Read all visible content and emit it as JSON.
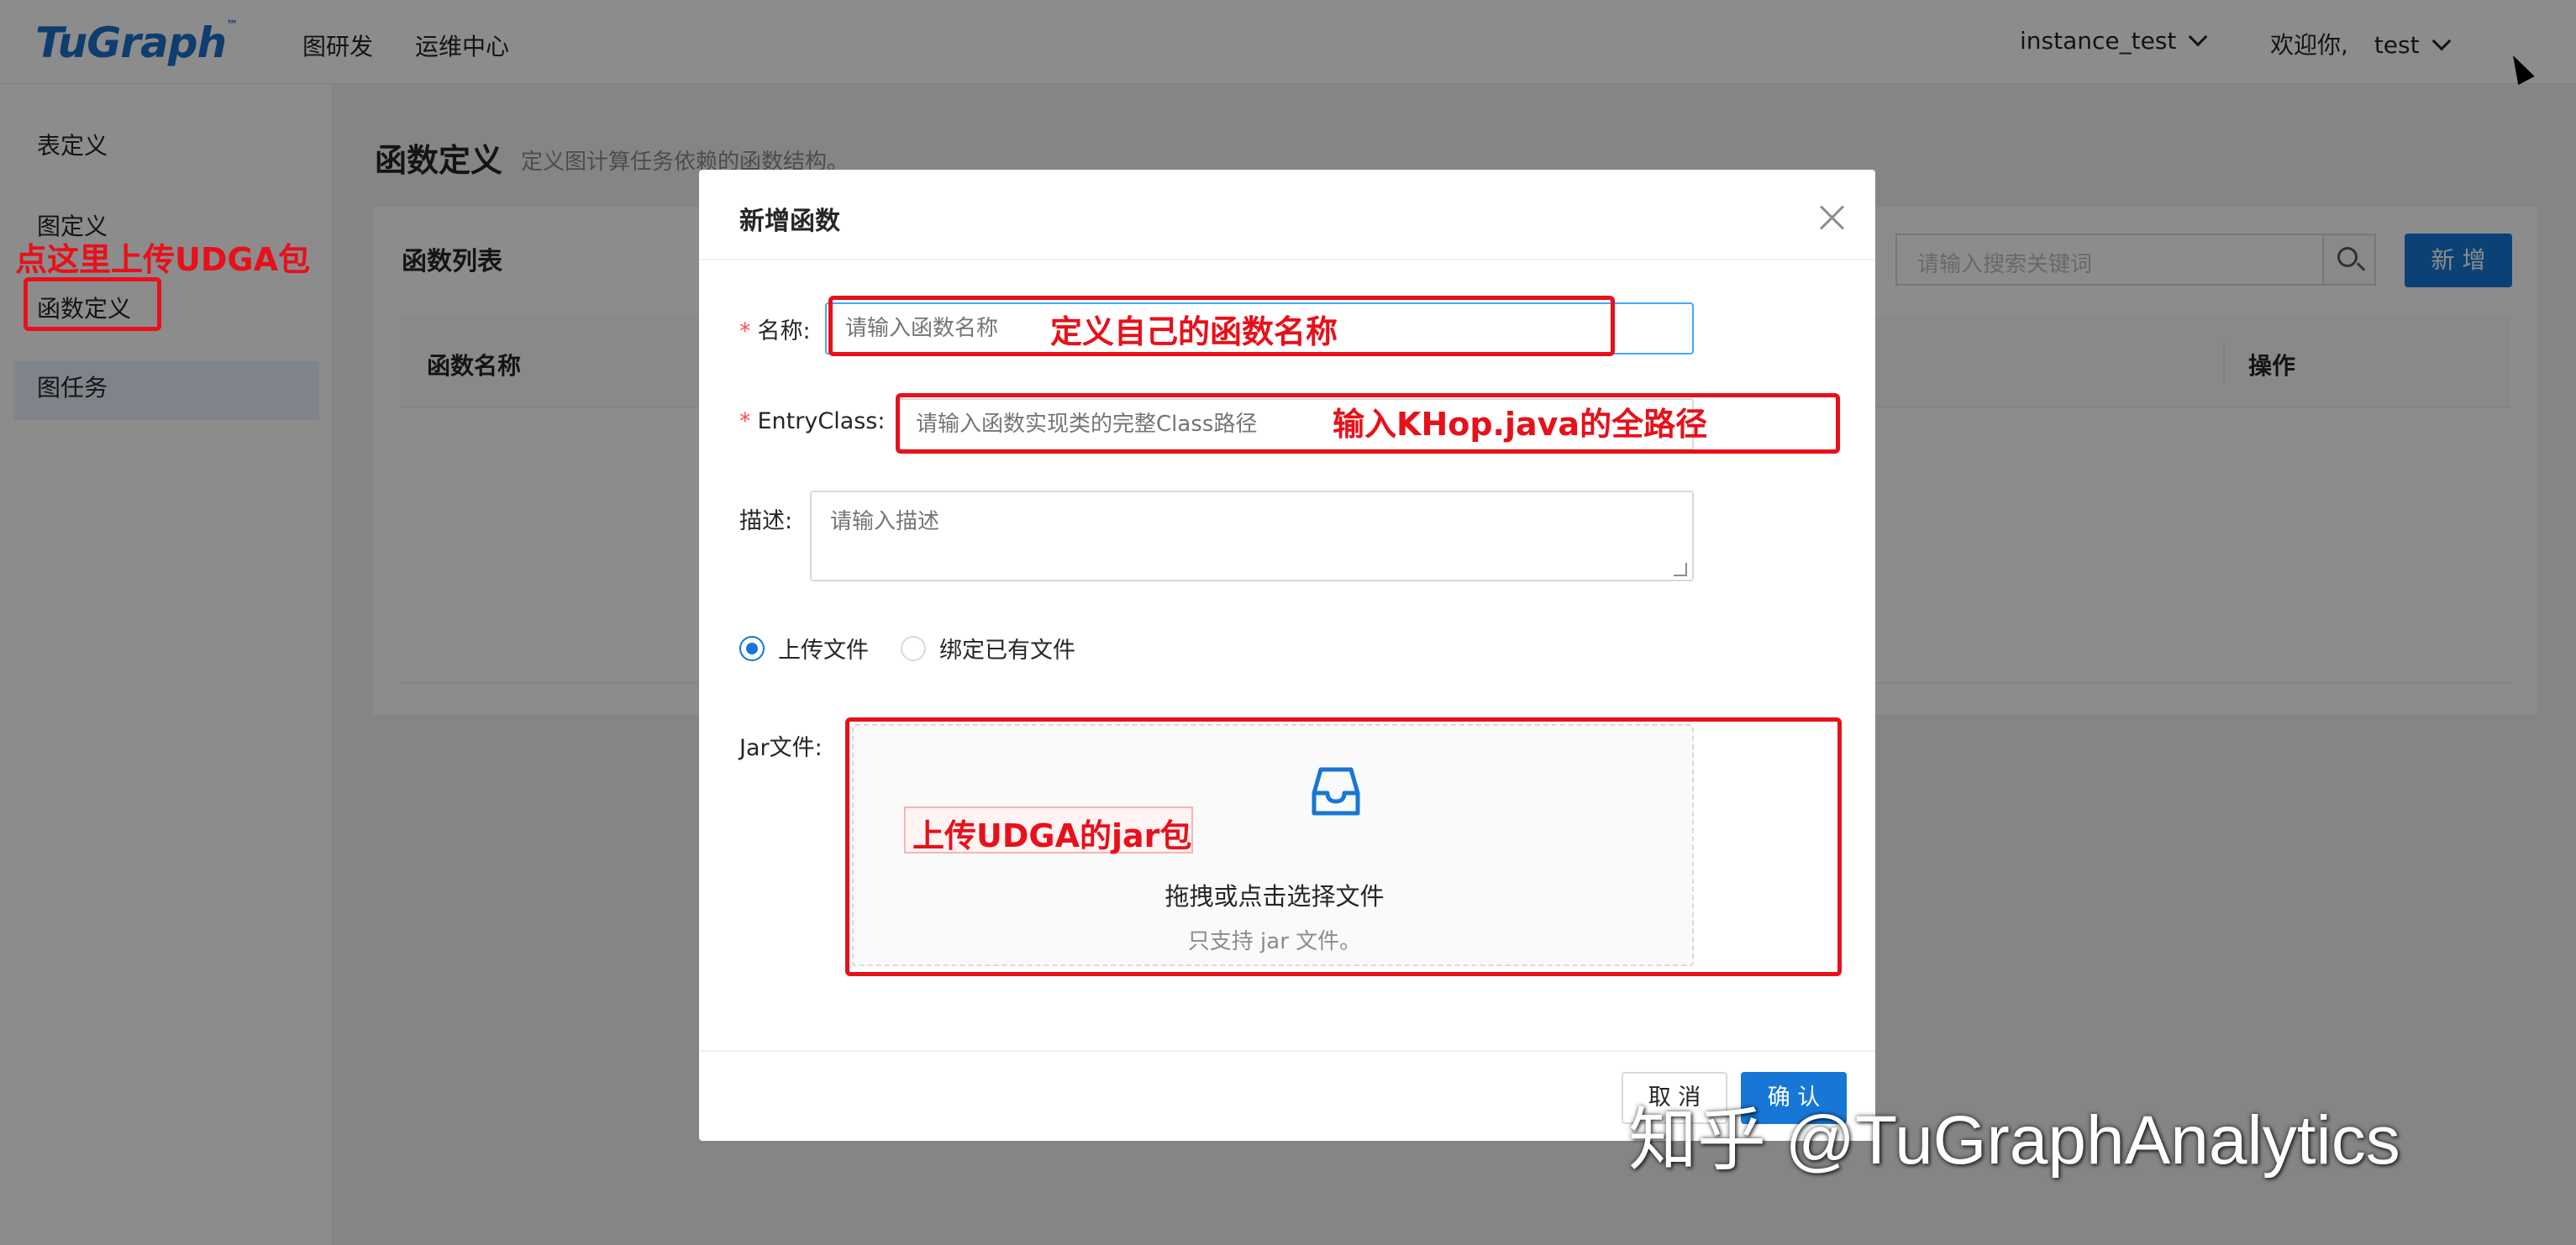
{
  "app": {
    "logo": "TuGraph",
    "logo_tm": "™",
    "nav": [
      "图研发",
      "运维中心"
    ],
    "instance": "instance_test",
    "greeting": "欢迎你,",
    "user": "test"
  },
  "sidebar": {
    "items": [
      {
        "label": "表定义"
      },
      {
        "label": "图定义"
      },
      {
        "label": "函数定义",
        "selected": true
      },
      {
        "label": "图任务"
      }
    ]
  },
  "page": {
    "title": "函数定义",
    "subtitle": "定义图计算任务依赖的函数结构。",
    "card_title": "函数列表",
    "search_placeholder": "请输入搜索关键词",
    "add_label": "新 增",
    "columns": [
      "函数名称",
      "操作"
    ]
  },
  "modal": {
    "title": "新增函数",
    "name_label": "名称:",
    "name_placeholder": "请输入函数名称",
    "entry_label": "EntryClass:",
    "entry_placeholder": "请输入函数实现类的完整Class路径",
    "desc_label": "描述:",
    "desc_placeholder": "请输入描述",
    "radio_upload": "上传文件",
    "radio_bind": "绑定已有文件",
    "radio_selected": "上传文件",
    "jar_label": "Jar文件:",
    "drop_main": "拖拽或点击选择文件",
    "drop_hint": "只支持 jar 文件。",
    "cancel_label": "取 消",
    "ok_label": "确 认"
  },
  "annotations": {
    "sidebar_note": "点这里上传UDGA包",
    "name_note": "定义自己的函数名称",
    "entry_note": "输入KHop.java的全路径",
    "jar_note": "上传UDGA的jar包",
    "color": "#e8101a"
  },
  "watermark": "知乎 @TuGraphAnalytics",
  "colors": {
    "primary": "#1677d6",
    "required": "#ff4d4f",
    "selected_bg": "#e6f0fb"
  }
}
